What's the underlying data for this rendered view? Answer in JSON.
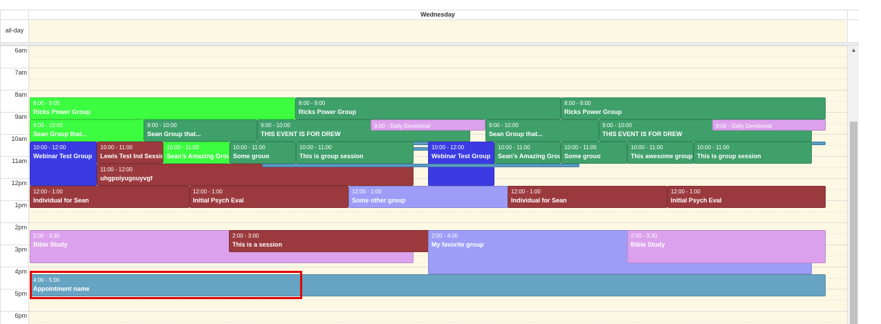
{
  "header": {
    "day": "Wednesday",
    "allday_label": "all-day"
  },
  "time_labels": [
    "6am",
    "7am",
    "8am",
    "9am",
    "10am",
    "11am",
    "12pm",
    "1pm",
    "2pm",
    "3pm",
    "4pm",
    "5pm",
    "6pm"
  ],
  "colors": {
    "green": "#3fa06a",
    "bright_green": "#3cfd40",
    "dark_red": "#9b3a3e",
    "blue": "#3b3be4",
    "lavender": "#9d9df8",
    "pink": "#dca1ec",
    "teal": "#67a3c2",
    "focus": "#e00000"
  },
  "events": [
    {
      "time": "8:00 - 9:00",
      "title": "Ricks Power Group"
    },
    {
      "time": "8:00 - 9:00",
      "title": "Ricks Power Group"
    },
    {
      "time": "8:00 - 9:00",
      "title": "Ricks Power Group"
    },
    {
      "time": "9:00 - 10:00",
      "title": "Sean Group that..."
    },
    {
      "time": "9:00 - 10:00",
      "title": "Sean Group that..."
    },
    {
      "time": "9:00 - 10:00",
      "title": "THIS EVENT IS FOR DREW"
    },
    {
      "time": "9:00 - 10:00",
      "title": "Sean Group that..."
    },
    {
      "time": "9:00 - 10:00",
      "title": "THIS EVENT IS FOR DREW"
    },
    {
      "time": "9:00",
      "title": "Daily Devotional"
    },
    {
      "time": "9:00",
      "title": "Daily Devotional"
    },
    {
      "time": "10:00 - 12:00",
      "title": "Webinar Test Group"
    },
    {
      "time": "10:00 - 11:00",
      "title": "Lewis Test Ind Session"
    },
    {
      "time": "10:00 - 11:00",
      "title": "Sean's Amazing Group"
    },
    {
      "time": "10:00 - 11:00",
      "title": "Some grouo"
    },
    {
      "time": "10:00 - 11:00",
      "title": "This is group session"
    },
    {
      "time": "10:00 - 12:00",
      "title": "Webinar Test Group"
    },
    {
      "time": "10:00 - 11:00",
      "title": "Sean's Amazing Group"
    },
    {
      "time": "10:00 - 11:00",
      "title": "Some grouo"
    },
    {
      "time": "10:00 - 11:00",
      "title": "This awesome group"
    },
    {
      "time": "10:00 - 11:00",
      "title": "This is group session"
    },
    {
      "time": "11:00 - 12:00",
      "title": "uhgpoiyugouyvgf"
    },
    {
      "time": "12:00 - 1:00",
      "title": "Individual for Sean"
    },
    {
      "time": "12:00 - 1:00",
      "title": "Initial Psych Eval"
    },
    {
      "time": "12:00 - 1:00",
      "title": "Some other group"
    },
    {
      "time": "12:00 - 1:00",
      "title": "Individual for Sean"
    },
    {
      "time": "12:00 - 1:00",
      "title": "Initial Psych Eval"
    },
    {
      "time": "2:00 - 3:30",
      "title": "Bible Study"
    },
    {
      "time": "2:00 - 3:00",
      "title": "This is a session"
    },
    {
      "time": "2:00 - 4:00",
      "title": "My favorite group"
    },
    {
      "time": "2:00 - 3:30",
      "title": "Bible Study"
    },
    {
      "time": "4:00 - 5:00",
      "title": "Appointment name"
    }
  ]
}
